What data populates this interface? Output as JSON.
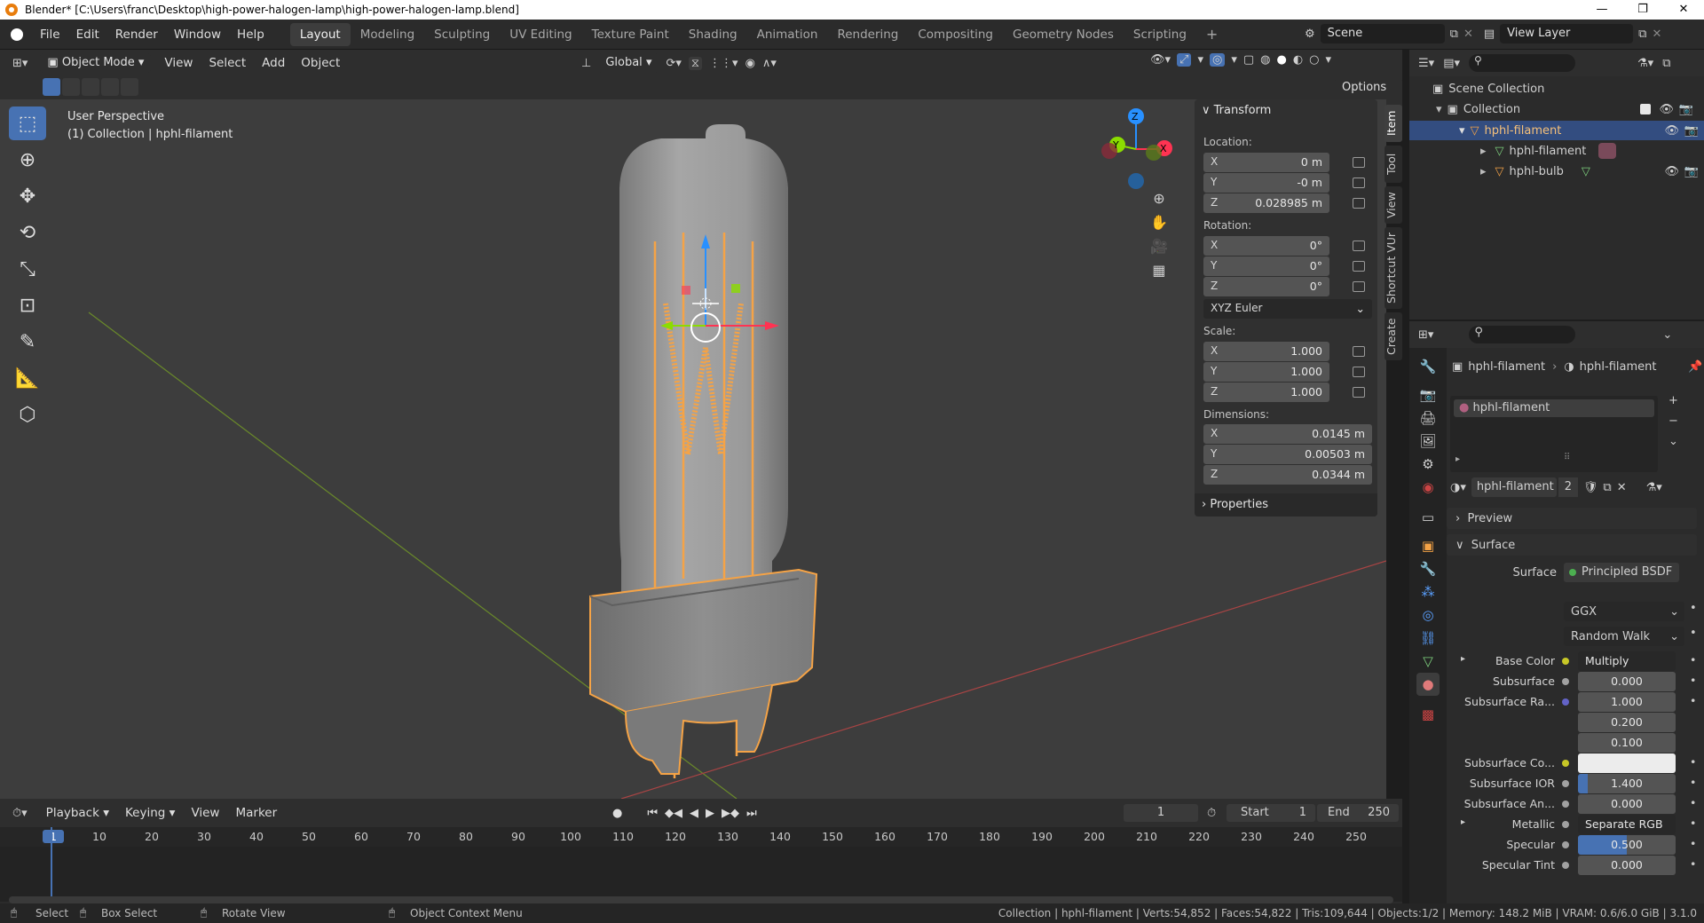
{
  "titlebar": {
    "title": "Blender* [C:\\Users\\franc\\Desktop\\high-power-halogen-lamp\\high-power-halogen-lamp.blend]"
  },
  "menu": [
    "File",
    "Edit",
    "Render",
    "Window",
    "Help"
  ],
  "workspaces": [
    "Layout",
    "Modeling",
    "Sculpting",
    "UV Editing",
    "Texture Paint",
    "Shading",
    "Animation",
    "Rendering",
    "Compositing",
    "Geometry Nodes",
    "Scripting"
  ],
  "scene": {
    "label": "Scene",
    "view_layer": "View Layer"
  },
  "viewport_header": {
    "mode": "Object Mode",
    "menus": [
      "View",
      "Select",
      "Add",
      "Object"
    ],
    "orientation": "Global",
    "options": "Options"
  },
  "viewport": {
    "perspective": "User Perspective",
    "collection": "(1) Collection | hphl-filament"
  },
  "gizmo": {
    "x": "X",
    "y": "Y",
    "z": "Z"
  },
  "npanel": {
    "transform_title": "Transform",
    "location_label": "Location:",
    "location": [
      {
        "axis": "X",
        "value": "0 m"
      },
      {
        "axis": "Y",
        "value": "-0 m"
      },
      {
        "axis": "Z",
        "value": "0.028985 m"
      }
    ],
    "rotation_label": "Rotation:",
    "rotation": [
      {
        "axis": "X",
        "value": "0°"
      },
      {
        "axis": "Y",
        "value": "0°"
      },
      {
        "axis": "Z",
        "value": "0°"
      }
    ],
    "rotation_mode": "XYZ Euler",
    "scale_label": "Scale:",
    "scale": [
      {
        "axis": "X",
        "value": "1.000"
      },
      {
        "axis": "Y",
        "value": "1.000"
      },
      {
        "axis": "Z",
        "value": "1.000"
      }
    ],
    "dimensions_label": "Dimensions:",
    "dimensions": [
      {
        "axis": "X",
        "value": "0.0145 m"
      },
      {
        "axis": "Y",
        "value": "0.00503 m"
      },
      {
        "axis": "Z",
        "value": "0.0344 m"
      }
    ],
    "properties_title": "Properties"
  },
  "side_tabs": [
    "Item",
    "Tool",
    "View",
    "Shortcut VUr",
    "Create"
  ],
  "outliner": {
    "scene_collection": "Scene Collection",
    "collection": "Collection",
    "items": [
      "hphl-filament",
      "hphl-filament",
      "hphl-bulb"
    ]
  },
  "props": {
    "breadcrumb_obj": "hphl-filament",
    "breadcrumb_mat": "hphl-filament",
    "slot": "hphl-filament",
    "material": "hphl-filament",
    "users": "2",
    "preview": "Preview",
    "surface_section": "Surface",
    "surface_label": "Surface",
    "surface_value": "Principled BSDF",
    "distribution": "GGX",
    "subsurface_method": "Random Walk",
    "rows": [
      {
        "label": "Base Color",
        "value": "Multiply",
        "dot": "#c7c727",
        "expand": true
      },
      {
        "label": "Subsurface",
        "value": "0.000",
        "dot": "#a1a1a1"
      },
      {
        "label": "Subsurface Ra...",
        "value": "1.000",
        "dot": "#6363c7"
      },
      {
        "label": "",
        "value": "0.200"
      },
      {
        "label": "",
        "value": "0.100"
      },
      {
        "label": "Subsurface Co...",
        "value": "",
        "dot": "#c7c727",
        "swatch": "#ececec"
      },
      {
        "label": "Subsurface IOR",
        "value": "1.400",
        "dot": "#a1a1a1"
      },
      {
        "label": "Subsurface An...",
        "value": "0.000",
        "dot": "#a1a1a1"
      },
      {
        "label": "Metallic",
        "value": "Separate RGB",
        "dot": "#a1a1a1",
        "expand": true
      },
      {
        "label": "Specular",
        "value": "0.500",
        "dot": "#a1a1a1"
      },
      {
        "label": "Specular Tint",
        "value": "0.000",
        "dot": "#a1a1a1"
      }
    ]
  },
  "timeline": {
    "menus": [
      "Playback",
      "Keying",
      "View",
      "Marker"
    ],
    "current_frame": "1",
    "start_label": "Start",
    "start": "1",
    "end_label": "End",
    "end": "250",
    "ticks": [
      "1",
      "10",
      "20",
      "30",
      "40",
      "50",
      "60",
      "70",
      "80",
      "90",
      "100",
      "110",
      "120",
      "130",
      "140",
      "150",
      "160",
      "170",
      "180",
      "190",
      "200",
      "210",
      "220",
      "230",
      "240",
      "250"
    ]
  },
  "status": {
    "select": "Select",
    "box_select": "Box Select",
    "rotate": "Rotate View",
    "context": "Object Context Menu",
    "info": "Collection | hphl-filament | Verts:54,852 | Faces:54,822 | Tris:109,644 | Objects:1/2 | Memory: 148.2 MiB | VRAM: 0.6/6.0 GiB | 3.1.0"
  },
  "colors": {
    "accent": "#4772b3",
    "selection": "#f5a346",
    "axis_x": "#ff3352",
    "axis_y": "#8bdc00",
    "axis_z": "#2890ff"
  }
}
